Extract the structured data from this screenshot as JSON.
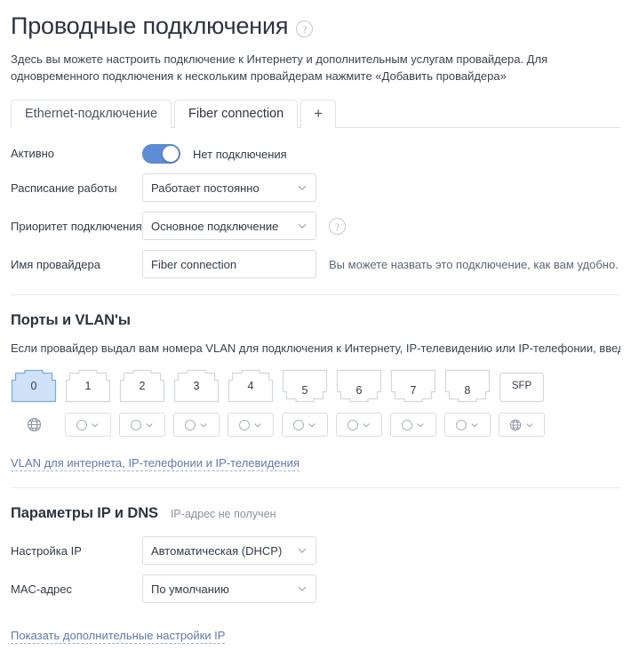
{
  "header": {
    "title": "Проводные подключения",
    "help_icon": "question-circle-icon",
    "intro": "Здесь вы можете настроить подключение к Интернету и дополнительным услугам провайдера. Для одновременного подключения к нескольким провайдерам нажмите «Добавить провайдера»"
  },
  "tabs": [
    {
      "label": "Ethernet-подключение",
      "active": false
    },
    {
      "label": "Fiber connection",
      "active": true
    },
    {
      "label": "+",
      "active": false
    }
  ],
  "form": {
    "active": {
      "label": "Активно",
      "toggle_on": true,
      "status_text": "Нет подключения"
    },
    "schedule": {
      "label": "Расписание работы",
      "value": "Работает постоянно"
    },
    "priority": {
      "label": "Приоритет подключения",
      "value": "Основное подключение",
      "help_icon": "question-circle-icon"
    },
    "provider_name": {
      "label": "Имя провайдера",
      "value": "Fiber connection",
      "hint": "Вы можете назвать это подключение, как вам удобно."
    }
  },
  "ports_section": {
    "title": "Порты и VLAN'ы",
    "description": "Если провайдер выдал вам номера VLAN для подключения к Интернету, IP-телевидению или IP-телефонии, введите их в соответствующие поля",
    "ports": [
      {
        "label": "0",
        "shape": "up",
        "selected": true
      },
      {
        "label": "1",
        "shape": "up",
        "selected": false
      },
      {
        "label": "2",
        "shape": "up",
        "selected": false
      },
      {
        "label": "3",
        "shape": "up",
        "selected": false
      },
      {
        "label": "4",
        "shape": "up",
        "selected": false
      },
      {
        "label": "5",
        "shape": "down",
        "selected": false
      },
      {
        "label": "6",
        "shape": "down",
        "selected": false
      },
      {
        "label": "7",
        "shape": "down",
        "selected": false
      },
      {
        "label": "8",
        "shape": "down",
        "selected": false
      },
      {
        "label": "SFP",
        "shape": "sfp",
        "selected": false
      }
    ],
    "vlan_controls": [
      {
        "type": "globe-plain",
        "icon": "globe-icon"
      },
      {
        "type": "select",
        "icon": "circle-icon"
      },
      {
        "type": "select",
        "icon": "circle-icon"
      },
      {
        "type": "select",
        "icon": "circle-icon"
      },
      {
        "type": "select",
        "icon": "circle-icon"
      },
      {
        "type": "select",
        "icon": "circle-icon"
      },
      {
        "type": "select",
        "icon": "circle-icon"
      },
      {
        "type": "select",
        "icon": "circle-icon"
      },
      {
        "type": "select",
        "icon": "circle-icon"
      },
      {
        "type": "select",
        "icon": "globe-icon"
      }
    ],
    "vlan_link": "VLAN для интернета, IP-телефонии и IP-телевидения"
  },
  "ip_section": {
    "title": "Параметры IP и DNS",
    "note": "IP-адрес не получен",
    "ip_setup": {
      "label": "Настройка IP",
      "value": "Автоматическая (DHCP)"
    },
    "mac": {
      "label": "MAC-адрес",
      "value": "По умолчанию"
    },
    "advanced_link": "Показать дополнительные настройки IP"
  },
  "colors": {
    "accent": "#5b8cd4",
    "link": "#5f7ba8",
    "port_selected_fill": "#cfe2f7",
    "port_selected_border": "#7aa9dd",
    "border": "#d8dde3"
  }
}
